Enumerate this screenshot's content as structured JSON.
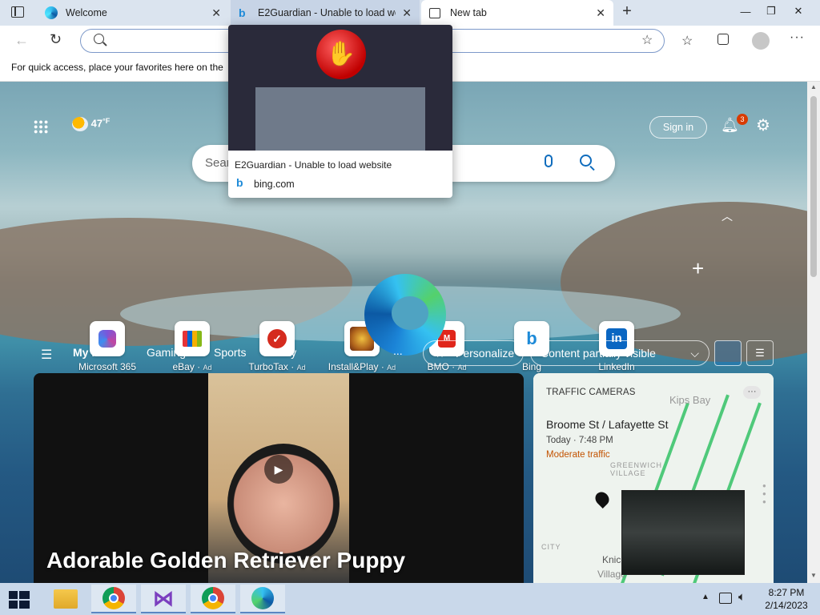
{
  "tabs": [
    {
      "title": "Welcome",
      "icon": "edge-icon"
    },
    {
      "title": "E2Guardian - Unable to load website",
      "icon": "bing-icon"
    },
    {
      "title": "New tab",
      "icon": "newtab-icon"
    }
  ],
  "window_controls": {
    "minimize": "—",
    "restore": "❐",
    "close": "✕"
  },
  "address_bar": {
    "value": "",
    "placeholder": ""
  },
  "favorites_bar": {
    "text": "For quick access, place your favorites here on the"
  },
  "tab_preview": {
    "title": "E2Guardian - Unable to load website",
    "domain": "bing.com"
  },
  "page": {
    "weather": {
      "temp": "47",
      "unit": "°F"
    },
    "sign_in": "Sign in",
    "notification_count": "3",
    "search": {
      "placeholder": "Sear"
    },
    "quick_links": [
      {
        "label": "Microsoft 365",
        "ad": "",
        "icon": "microsoft365-icon",
        "color": "#7b55d9"
      },
      {
        "label": "eBay",
        "ad": "Ad",
        "icon": "ebay-icon",
        "color": "#e53238"
      },
      {
        "label": "TurboTax",
        "ad": "Ad",
        "icon": "turbotax-icon",
        "color": "#d52b1e"
      },
      {
        "label": "Install&Play",
        "ad": "Ad",
        "icon": "game-icon",
        "color": "#b0641c"
      },
      {
        "label": "BMO",
        "ad": "Ad",
        "icon": "bmo-icon",
        "color": "#e0261b"
      },
      {
        "label": "Bing",
        "ad": "",
        "icon": "bing-icon",
        "color": "#1d8ad8"
      },
      {
        "label": "LinkedIn",
        "ad": "",
        "icon": "linkedin-icon",
        "color": "#0a66c2"
      }
    ],
    "feed_nav": {
      "items": [
        "My Feed",
        "Gaming",
        "Sports",
        "Play"
      ],
      "more": "...",
      "personalize": "Personalize",
      "content_visibility": "Content partially visible"
    },
    "video_card": {
      "title": "Adorable Golden Retriever Puppy"
    },
    "traffic_card": {
      "header": "TRAFFIC CAMERAS",
      "location": "Broome St / Lafayette St",
      "time": "Today · 7:48 PM",
      "status": "Moderate traffic",
      "status_color": "#c35200",
      "map_labels": [
        "Kips Bay",
        "GREENWICH VILLAGE",
        "Knickerb",
        "Village",
        "CITY"
      ]
    }
  },
  "taskbar": {
    "clock_time": "8:27 PM",
    "clock_date": "2/14/2023",
    "apps": [
      "file-explorer-icon",
      "chrome-icon",
      "visual-studio-icon",
      "chrome-icon",
      "edge-icon"
    ]
  },
  "colors": {
    "accent": "#0f6cbd",
    "notification_badge": "#d83b01"
  }
}
